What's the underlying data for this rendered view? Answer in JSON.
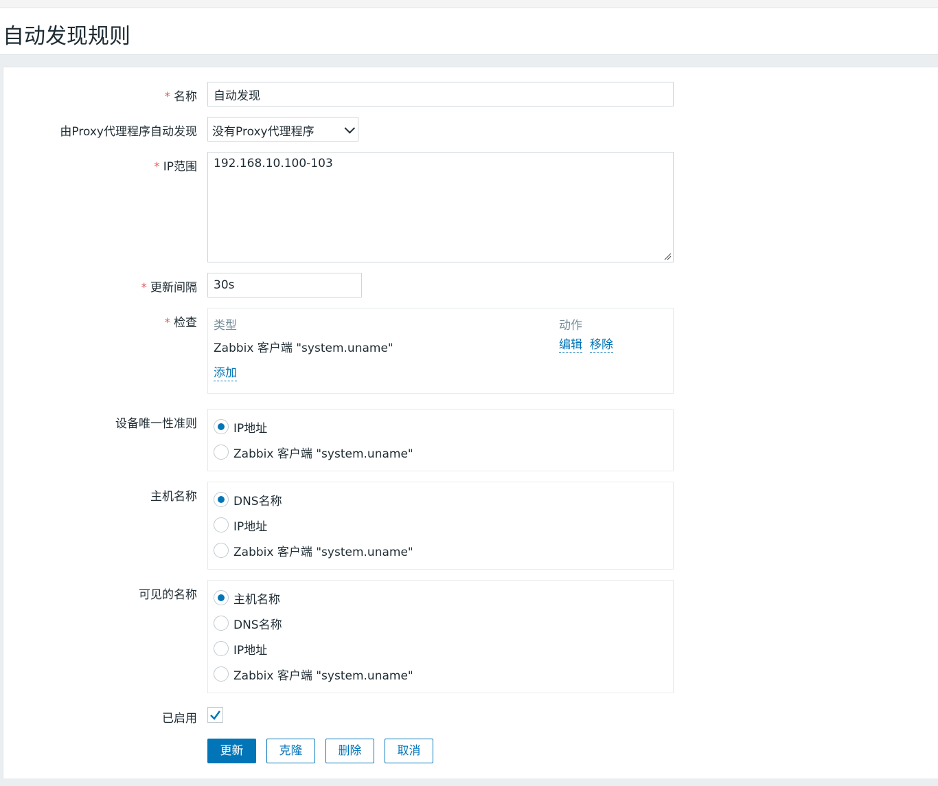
{
  "page_title": "自动发现规则",
  "form": {
    "name": {
      "label": "名称",
      "value": "自动发现"
    },
    "proxy": {
      "label": "由Proxy代理程序自动发现",
      "value": "没有Proxy代理程序"
    },
    "ip_range": {
      "label": "IP范围",
      "value": "192.168.10.100-103"
    },
    "interval": {
      "label": "更新间隔",
      "value": "30s"
    },
    "checks": {
      "label": "检查",
      "col_type": "类型",
      "col_action": "动作",
      "rows": [
        {
          "type": "Zabbix 客户端 \"system.uname\"",
          "edit": "编辑",
          "remove": "移除"
        }
      ],
      "add": "添加"
    },
    "uniqueness": {
      "label": "设备唯一性准则",
      "options": [
        "IP地址",
        "Zabbix 客户端 \"system.uname\""
      ],
      "selected": 0
    },
    "host_name": {
      "label": "主机名称",
      "options": [
        "DNS名称",
        "IP地址",
        "Zabbix 客户端 \"system.uname\""
      ],
      "selected": 0
    },
    "visible_name": {
      "label": "可见的名称",
      "options": [
        "主机名称",
        "DNS名称",
        "IP地址",
        "Zabbix 客户端 \"system.uname\""
      ],
      "selected": 0
    },
    "enabled": {
      "label": "已启用",
      "checked": true
    }
  },
  "buttons": {
    "update": "更新",
    "clone": "克隆",
    "delete": "删除",
    "cancel": "取消"
  },
  "colors": {
    "accent": "#0275b8",
    "required": "#e45959",
    "muted": "#768d99"
  }
}
